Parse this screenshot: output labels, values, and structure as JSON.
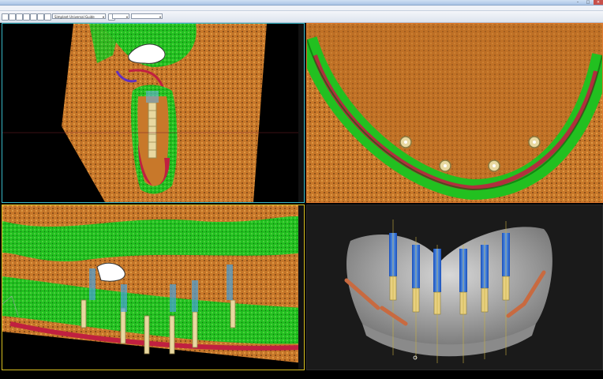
{
  "window": {
    "title": "",
    "minimize": "–",
    "maximize": "□",
    "close": "×"
  },
  "menu": [],
  "toolbar": {
    "guide_dropdown": "Simplant Universal Guide",
    "view_dropdown": "",
    "zoom_dropdown": ""
  },
  "colors": {
    "view_border_cyan": "#38b8c8",
    "view_border_orange": "#e07a30",
    "view_border_yellow": "#d8c020",
    "bone_green": "#28c820",
    "bone_red": "#c02040",
    "bone_orange": "#d9882a",
    "implant_blue": "#2a6fe0",
    "implant_gold": "#d8c880",
    "render_bg": "#1a1a1a"
  },
  "views": {
    "top_left": {
      "name": "cross-section-view"
    },
    "top_right": {
      "name": "axial-view"
    },
    "bottom_left": {
      "name": "panoramic-view"
    },
    "bottom_right": {
      "name": "3d-render-view"
    }
  }
}
